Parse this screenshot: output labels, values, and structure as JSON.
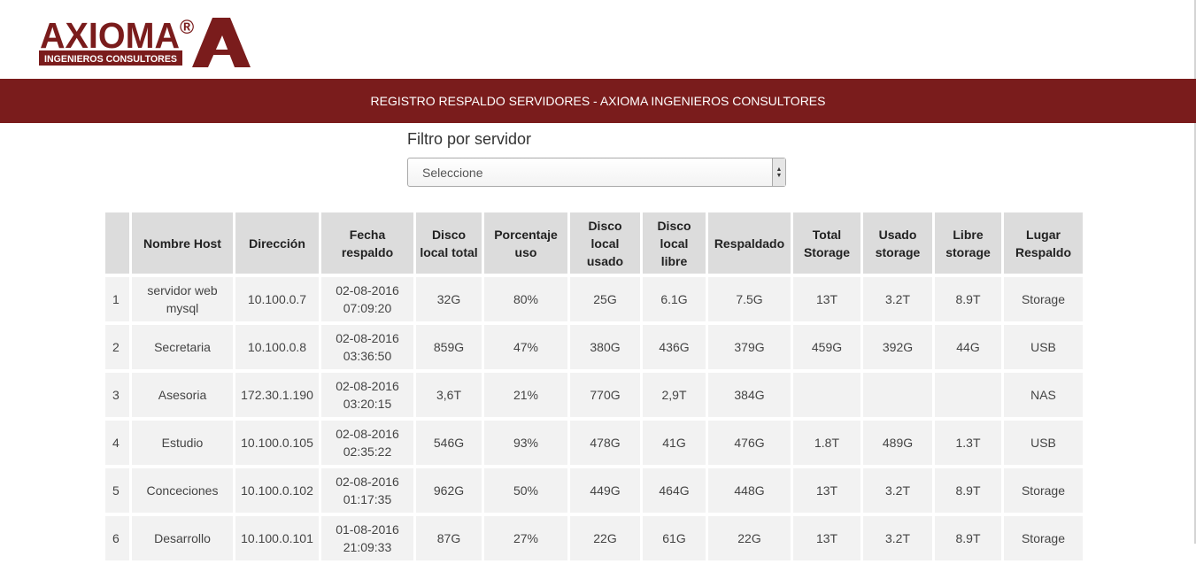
{
  "logo": {
    "brand": "AXIOMA",
    "registered_mark": "®",
    "tagline": "INGENIEROS CONSULTORES",
    "letter": "A"
  },
  "banner": {
    "title": "REGISTRO RESPALDO SERVIDORES - AXIOMA INGENIEROS CONSULTORES"
  },
  "filter": {
    "label": "Filtro por servidor",
    "selected": "Seleccione"
  },
  "table": {
    "headers": [
      "",
      "Nombre Host",
      "Dirección",
      "Fecha respaldo",
      "Disco local total",
      "Porcentaje uso",
      "Disco local usado",
      "Disco local libre",
      "Respaldado",
      "Total Storage",
      "Usado storage",
      "Libre storage",
      "Lugar Respaldo"
    ],
    "rows": [
      [
        "1",
        "servidor web mysql",
        "10.100.0.7",
        "02-08-2016 07:09:20",
        "32G",
        "80%",
        "25G",
        "6.1G",
        "7.5G",
        "13T",
        "3.2T",
        "8.9T",
        "Storage"
      ],
      [
        "2",
        "Secretaria",
        "10.100.0.8",
        "02-08-2016 03:36:50",
        "859G",
        "47%",
        "380G",
        "436G",
        "379G",
        "459G",
        "392G",
        "44G",
        "USB"
      ],
      [
        "3",
        "Asesoria",
        "172.30.1.190",
        "02-08-2016 03:20:15",
        "3,6T",
        "21%",
        "770G",
        "2,9T",
        "384G",
        "",
        "",
        "",
        "NAS"
      ],
      [
        "4",
        "Estudio",
        "10.100.0.105",
        "02-08-2016 02:35:22",
        "546G",
        "93%",
        "478G",
        "41G",
        "476G",
        "1.8T",
        "489G",
        "1.3T",
        "USB"
      ],
      [
        "5",
        "Conceciones",
        "10.100.0.102",
        "02-08-2016 01:17:35",
        "962G",
        "50%",
        "449G",
        "464G",
        "448G",
        "13T",
        "3.2T",
        "8.9T",
        "Storage"
      ],
      [
        "6",
        "Desarrollo",
        "10.100.0.101",
        "01-08-2016 21:09:33",
        "87G",
        "27%",
        "22G",
        "61G",
        "22G",
        "13T",
        "3.2T",
        "8.9T",
        "Storage"
      ]
    ]
  },
  "colors": {
    "banner": "#7a1c1c",
    "header_cell": "#dcdcdc",
    "data_cell": "#f2f2f2"
  }
}
